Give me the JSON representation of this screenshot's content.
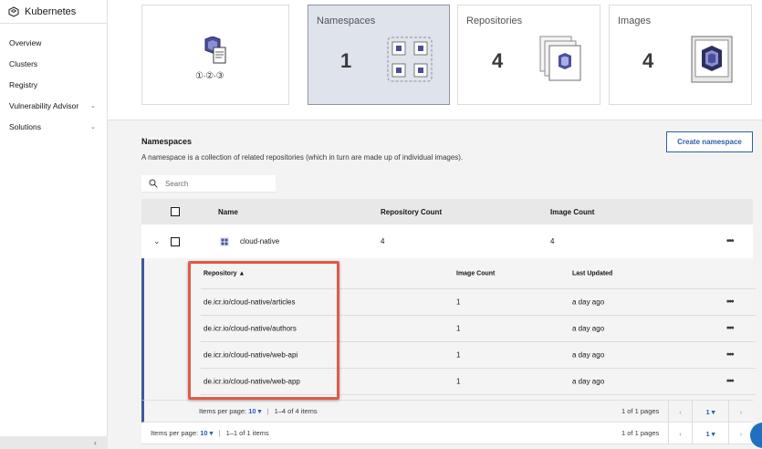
{
  "sidebar": {
    "title": "Kubernetes",
    "items": [
      {
        "label": "Overview",
        "chevron": false
      },
      {
        "label": "Clusters",
        "chevron": false
      },
      {
        "label": "Registry",
        "chevron": false
      },
      {
        "label": "Vulnerability Advisor",
        "chevron": true
      },
      {
        "label": "Solutions",
        "chevron": true
      }
    ],
    "collapse_glyph": "‹"
  },
  "cards": {
    "quickstart": {
      "steps": "①·②·③"
    },
    "namespaces": {
      "title": "Namespaces",
      "count": "1"
    },
    "repositories": {
      "title": "Repositories",
      "count": "4"
    },
    "images": {
      "title": "Images",
      "count": "4"
    }
  },
  "section": {
    "title": "Namespaces",
    "description": "A namespace is a collection of related repositories (which in turn are made up of individual images).",
    "create_button": "Create namespace",
    "search_placeholder": "Search"
  },
  "table": {
    "headers": {
      "name": "Name",
      "repo_count": "Repository Count",
      "image_count": "Image Count"
    },
    "rows": [
      {
        "name": "cloud-native",
        "repo_count": "4",
        "image_count": "4"
      }
    ]
  },
  "repos": {
    "headers": {
      "repository": "Repository ▲",
      "image_count": "Image Count",
      "last_updated": "Last Updated"
    },
    "rows": [
      {
        "repository": "de.icr.io/cloud-native/articles",
        "image_count": "1",
        "last_updated": "a day ago"
      },
      {
        "repository": "de.icr.io/cloud-native/authors",
        "image_count": "1",
        "last_updated": "a day ago"
      },
      {
        "repository": "de.icr.io/cloud-native/web-api",
        "image_count": "1",
        "last_updated": "a day ago"
      },
      {
        "repository": "de.icr.io/cloud-native/web-app",
        "image_count": "1",
        "last_updated": "a day ago"
      }
    ],
    "pager": {
      "label": "Items per page:",
      "per_page": "10 ▾",
      "range": "1–4 of 4 items",
      "pages": "1 of 1 pages",
      "page": "1 ▾"
    }
  },
  "pager": {
    "label": "Items per page:",
    "per_page": "10 ▾",
    "range": "1–1 of 1 items",
    "pages": "1 of 1 pages",
    "page": "1 ▾"
  },
  "colors": {
    "accent": "#2c5fab",
    "highlight": "#e05a4a",
    "active_card": "#dfe4ec"
  }
}
